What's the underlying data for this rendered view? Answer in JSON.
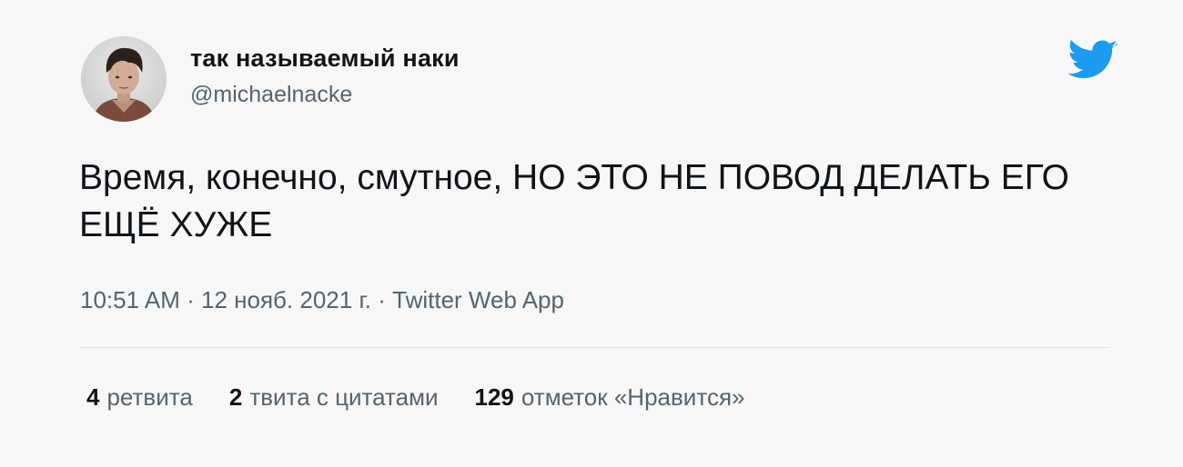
{
  "author": {
    "display_name": "так называемый наки",
    "handle": "@michaelnacke"
  },
  "tweet": {
    "text": "Время, конечно, смутное, НО ЭТО НЕ ПОВОД ДЕЛАТЬ ЕГО ЕЩЁ ХУЖЕ",
    "time": "10:51 AM",
    "date": "12 нояб. 2021 г.",
    "source": "Twitter Web App",
    "separator": "·"
  },
  "stats": [
    {
      "count": "4",
      "label": "ретвита"
    },
    {
      "count": "2",
      "label": "твита с цитатами"
    },
    {
      "count": "129",
      "label": "отметок «Нравится»"
    }
  ],
  "icons": {
    "brand": "twitter-bird-icon",
    "avatar": "user-avatar"
  },
  "colors": {
    "twitter_blue": "#1d9bf0",
    "text_primary": "#0f1419",
    "text_secondary": "#536471",
    "background": "#f7f7f8"
  }
}
